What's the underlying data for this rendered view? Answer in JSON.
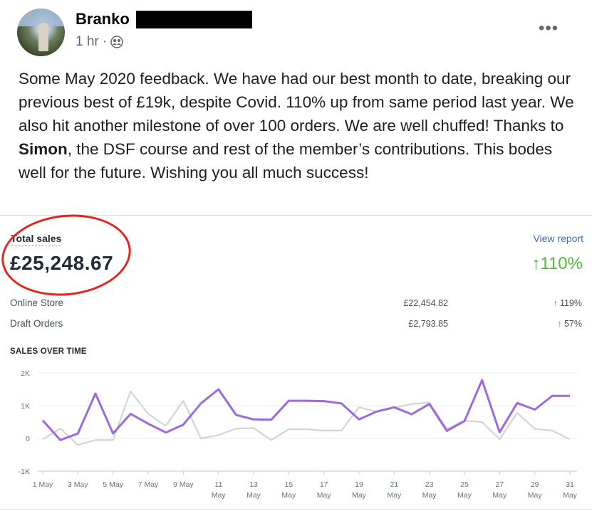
{
  "post": {
    "author": "Branko",
    "time": "1 hr",
    "audience_icon": "group-icon",
    "more_icon": "more-options-icon",
    "text_part1": "Some May 2020 feedback. We have had our best month to date, breaking our previous best of £19k, despite Covid. 110% up from same period last year. We also hit another milestone of over 100 orders. We are well chuffed! Thanks to ",
    "text_bold": "Simon",
    "text_part2": ", the DSF course and rest of the member’s contributions. This bodes well for the future. Wishing you all much success!"
  },
  "report": {
    "title": "Total sales",
    "total": "£25,248.67",
    "view_report": "View report",
    "growth": "110%",
    "rows": [
      {
        "label": "Online Store",
        "value": "£22,454.82",
        "pct": "119%"
      },
      {
        "label": "Draft Orders",
        "value": "£2,793.85",
        "pct": "57%"
      }
    ],
    "chart_title": "SALES OVER TIME",
    "colors": {
      "accent": "#9c6ade",
      "comparison": "#d4d4d4",
      "growth": "#50b83c",
      "annotation": "#e0271f"
    }
  },
  "chart_data": {
    "type": "line",
    "title": "SALES OVER TIME",
    "ylim": [
      -1000,
      2000
    ],
    "y_ticks": [
      {
        "v": 2000,
        "label": "2K"
      },
      {
        "v": 1000,
        "label": "1K"
      },
      {
        "v": 0,
        "label": "0"
      },
      {
        "v": -1000,
        "label": "-1K"
      }
    ],
    "x_ticks": [
      {
        "day": 1,
        "l1": "1 May",
        "l2": ""
      },
      {
        "day": 3,
        "l1": "3 May",
        "l2": ""
      },
      {
        "day": 5,
        "l1": "5 May",
        "l2": ""
      },
      {
        "day": 7,
        "l1": "7 May",
        "l2": ""
      },
      {
        "day": 9,
        "l1": "9 May",
        "l2": ""
      },
      {
        "day": 11,
        "l1": "11",
        "l2": "May"
      },
      {
        "day": 13,
        "l1": "13",
        "l2": "May"
      },
      {
        "day": 15,
        "l1": "15",
        "l2": "May"
      },
      {
        "day": 17,
        "l1": "17",
        "l2": "May"
      },
      {
        "day": 19,
        "l1": "19",
        "l2": "May"
      },
      {
        "day": 21,
        "l1": "21",
        "l2": "May"
      },
      {
        "day": 23,
        "l1": "23",
        "l2": "May"
      },
      {
        "day": 25,
        "l1": "25",
        "l2": "May"
      },
      {
        "day": 27,
        "l1": "27",
        "l2": "May"
      },
      {
        "day": 29,
        "l1": "29",
        "l2": "May"
      },
      {
        "day": 31,
        "l1": "31",
        "l2": "May"
      }
    ],
    "x": [
      1,
      2,
      3,
      4,
      5,
      6,
      7,
      8,
      9,
      10,
      11,
      12,
      13,
      14,
      15,
      16,
      17,
      18,
      19,
      20,
      21,
      22,
      23,
      24,
      25,
      26,
      27,
      28,
      29,
      30,
      31
    ],
    "series": [
      {
        "values": [
          550,
          -50,
          150,
          1370,
          150,
          750,
          450,
          180,
          420,
          1070,
          1500,
          720,
          580,
          570,
          1150,
          1150,
          1140,
          1070,
          580,
          820,
          950,
          740,
          1050,
          230,
          530,
          1780,
          190,
          1080,
          880,
          1300,
          1300
        ]
      },
      {
        "values": [
          -30,
          300,
          -200,
          -50,
          -50,
          1440,
          750,
          380,
          1150,
          0,
          100,
          300,
          320,
          -50,
          280,
          280,
          240,
          240,
          950,
          820,
          940,
          1050,
          1100,
          300,
          540,
          500,
          -30,
          780,
          290,
          240,
          -30
        ]
      }
    ]
  }
}
